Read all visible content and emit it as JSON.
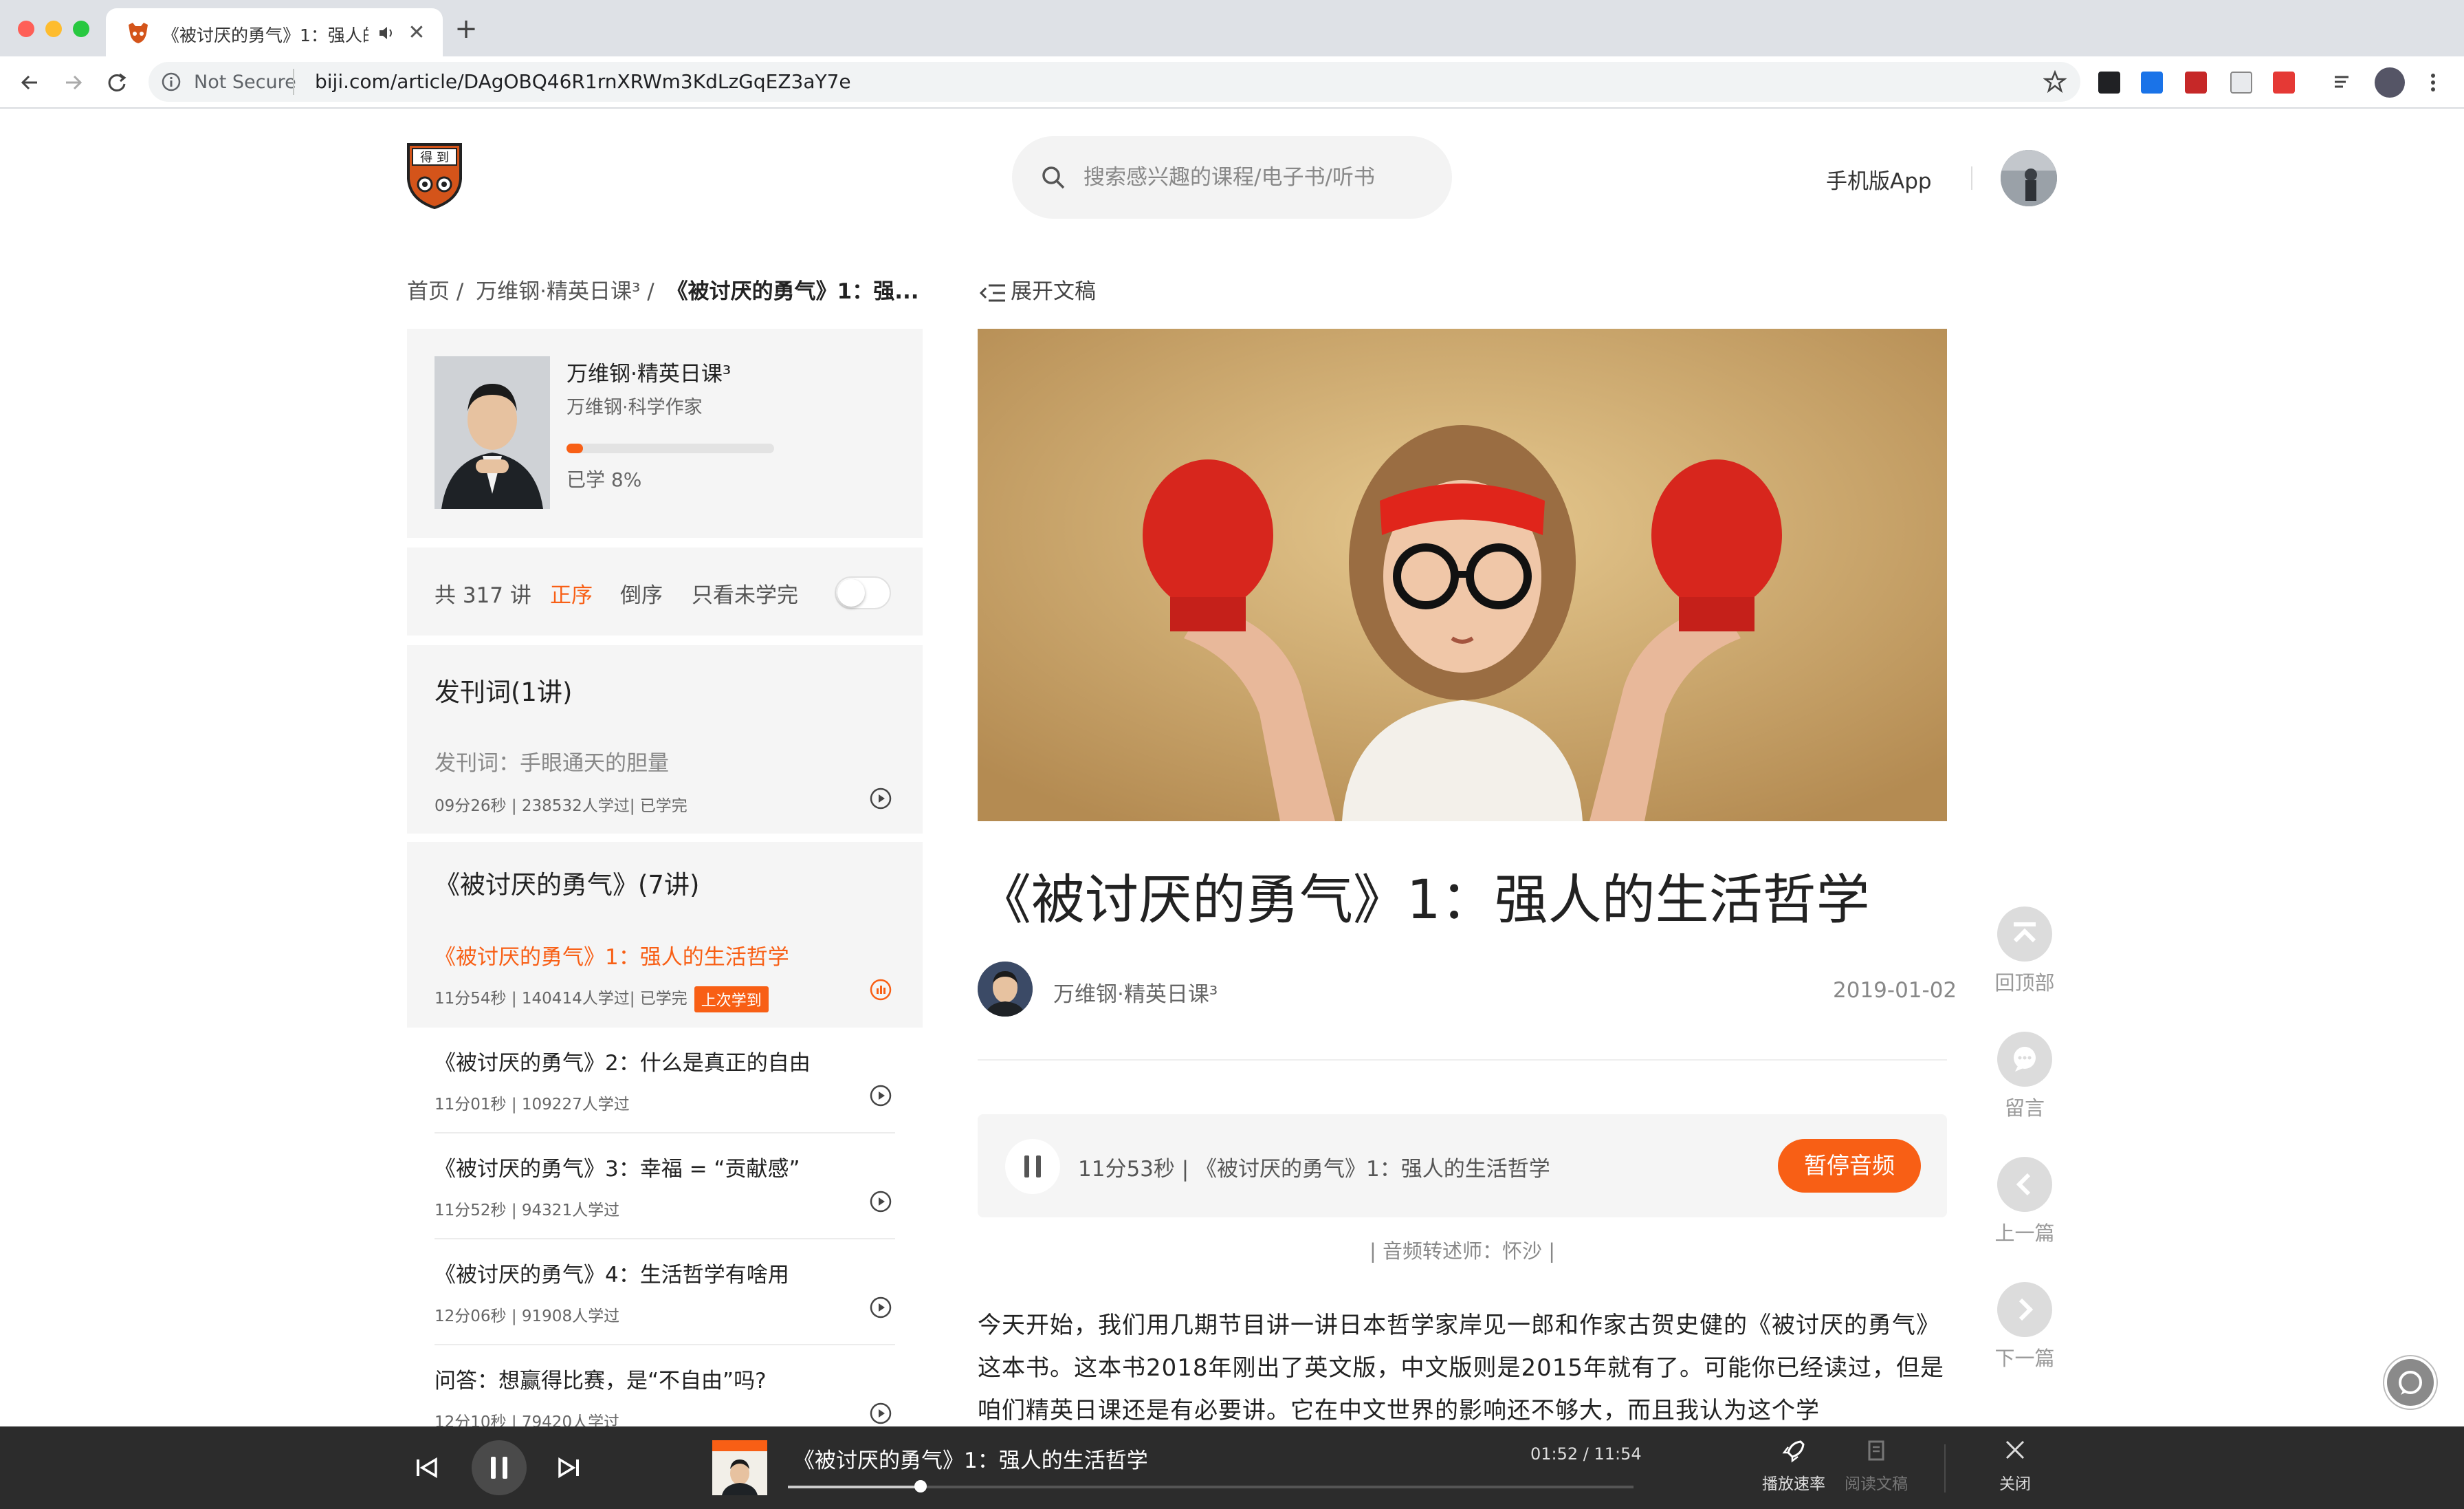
{
  "browser": {
    "tab_title": "《被讨厌的勇气》1：强人的",
    "tab_close": "✕",
    "new_tab": "+",
    "security_label": "Not Secure",
    "url": "biji.com/article/DAgOBQ46R1rnXRWm3KdLzGqEZ3aY7e"
  },
  "header": {
    "search_placeholder": "搜索感兴趣的课程/电子书/听书",
    "mobile_app": "手机版App"
  },
  "breadcrumb": {
    "home": "首页 /",
    "course": "万维钢·精英日课³ /",
    "current": "《被讨厌的勇气》1：强..."
  },
  "course": {
    "name": "万维钢·精英日课³",
    "author": "万维钢·科学作家",
    "progress_percent": 8,
    "progress_text": "已学 8%"
  },
  "sort_bar": {
    "count": "共 317 讲",
    "order_asc": "正序",
    "order_desc": "倒序",
    "unfinished_only": "只看未学完",
    "toggle_on": false
  },
  "chapters": [
    {
      "title": "发刊词(1讲)",
      "lessons": [
        {
          "title": "发刊词：手眼通天的胆量",
          "meta": "09分26秒 | 238532人学过| 已学完"
        }
      ]
    },
    {
      "title": "《被讨厌的勇气》(7讲)",
      "lessons": [
        {
          "title": "《被讨厌的勇气》1：强人的生活哲学",
          "meta": "11分54秒 | 140414人学过| 已学完",
          "badge": "上次学到"
        },
        {
          "title": "《被讨厌的勇气》2：什么是真正的自由",
          "meta": "11分01秒 | 109227人学过"
        },
        {
          "title": "《被讨厌的勇气》3：幸福 = “贡献感”",
          "meta": "11分52秒 | 94321人学过"
        },
        {
          "title": "《被讨厌的勇气》4：生活哲学有啥用",
          "meta": "12分06秒 | 91908人学过"
        },
        {
          "title": "问答：想赢得比赛，是“不自由”吗?",
          "meta": "12分10秒 | 79420人学过"
        }
      ]
    }
  ],
  "article": {
    "expand_label": "展开文稿",
    "title": "《被讨厌的勇气》1：强人的生活哲学",
    "author": "万维钢·精英日课³",
    "date": "2019-01-02",
    "audio_label": "11分53秒 | 《被讨厌的勇气》1：强人的生活哲学",
    "audio_button": "暂停音频",
    "transcriber": "| 音频转述师：怀沙 |",
    "body": "今天开始，我们用几期节目讲一讲日本哲学家岸见一郎和作家古贺史健的《被讨厌的勇气》这本书。这本书2018年刚出了英文版，中文版则是2015年就有了。可能你已经读过，但是咱们精英日课还是有必要讲。它在中文世界的影响还不够大，而且我认为这个学"
  },
  "side_tools": {
    "top": "回顶部",
    "comment": "留言",
    "prev": "上一篇",
    "next": "下一篇"
  },
  "player": {
    "title": "《被讨厌的勇气》1：强人的生活哲学",
    "time": "01:52 / 11:54",
    "progress": 0.157,
    "speed": "播放速率",
    "read": "阅读文稿",
    "close": "关闭"
  },
  "colors": {
    "accent": "#f85f15",
    "player_bg": "#2c2c2c"
  }
}
